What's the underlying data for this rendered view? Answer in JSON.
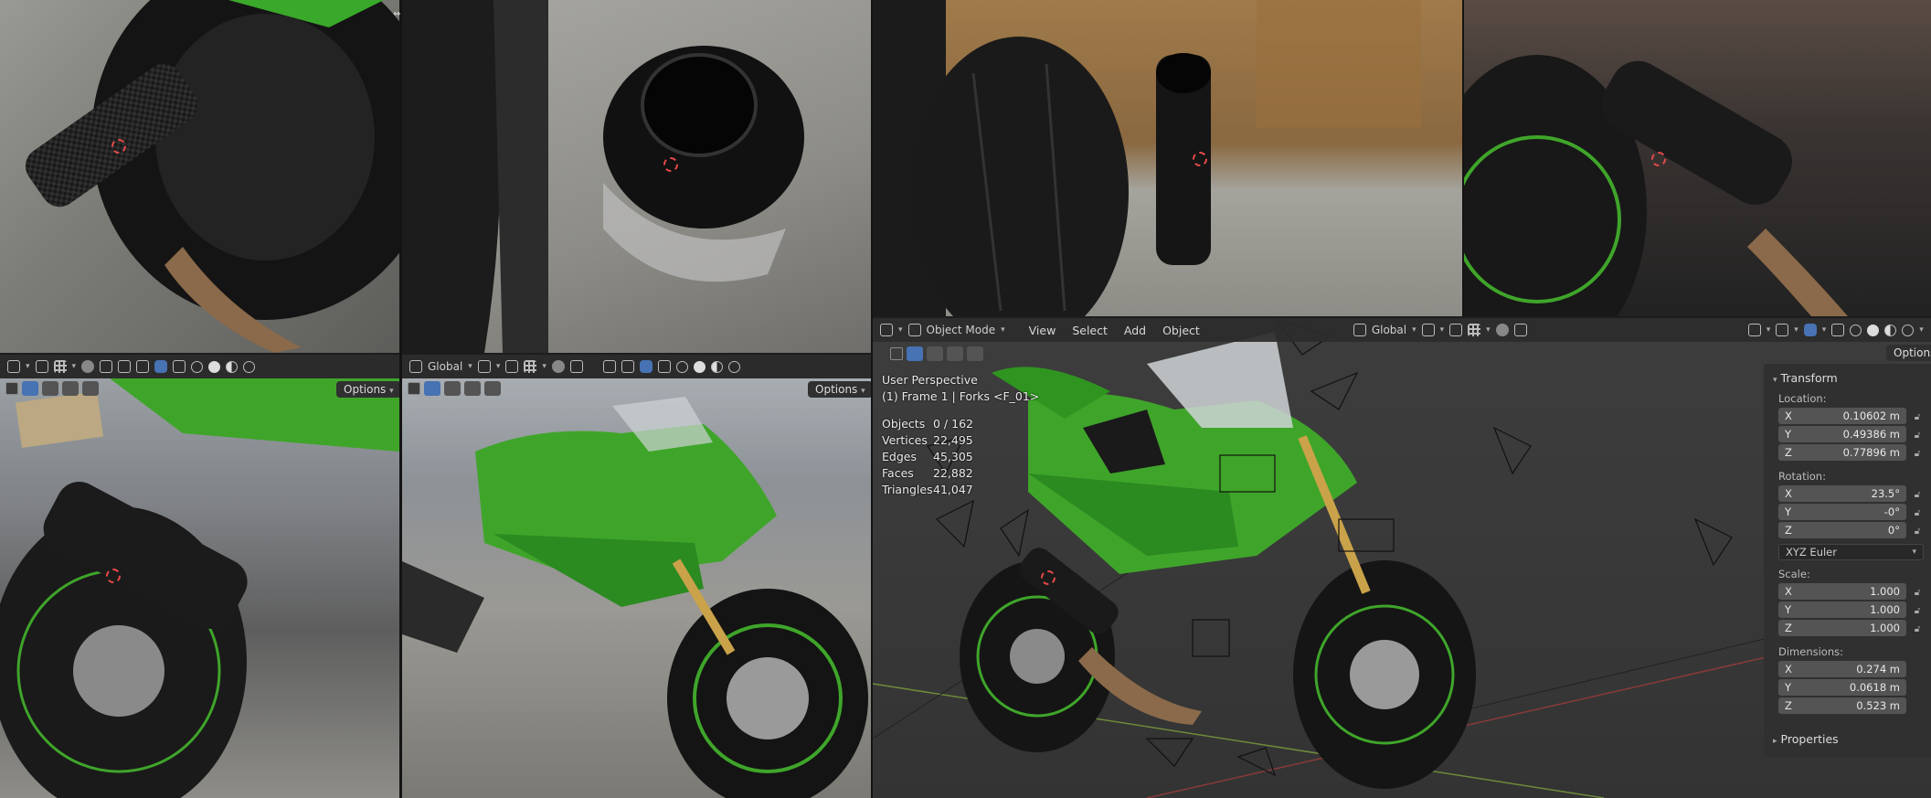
{
  "colors": {
    "accent_blue": "#4772b3",
    "bike_green": "#3fa52a",
    "toolbar_bg": "#2b2b2b"
  },
  "top_left_panel": {
    "divider_icon": "double-arrow-icon"
  },
  "bottom_left_toolbar": {
    "options_label": "Options"
  },
  "bottom_mid_toolbar": {
    "orientation_label": "Global",
    "options_label": "Options"
  },
  "main_viewport": {
    "header": {
      "mode_label": "Object Mode",
      "menus": [
        "View",
        "Select",
        "Add",
        "Object"
      ],
      "orientation_label": "Global",
      "options_label": "Options"
    },
    "overlay": {
      "perspective": "User Perspective",
      "frame_info": "(1) Frame 1 | Forks <F_01>"
    },
    "stats": [
      {
        "label": "Objects",
        "value": "0 / 162"
      },
      {
        "label": "Vertices",
        "value": "22,495"
      },
      {
        "label": "Edges",
        "value": "45,305"
      },
      {
        "label": "Faces",
        "value": "22,882"
      },
      {
        "label": "Triangles",
        "value": "41,047"
      }
    ]
  },
  "n_panel": {
    "transform_title": "Transform",
    "location_label": "Location:",
    "location": [
      {
        "axis": "X",
        "value": "0.10602 m"
      },
      {
        "axis": "Y",
        "value": "0.49386 m"
      },
      {
        "axis": "Z",
        "value": "0.77896 m"
      }
    ],
    "rotation_label": "Rotation:",
    "rotation": [
      {
        "axis": "X",
        "value": "23.5°"
      },
      {
        "axis": "Y",
        "value": "-0°"
      },
      {
        "axis": "Z",
        "value": "0°"
      }
    ],
    "rotation_mode": "XYZ Euler",
    "scale_label": "Scale:",
    "scale": [
      {
        "axis": "X",
        "value": "1.000"
      },
      {
        "axis": "Y",
        "value": "1.000"
      },
      {
        "axis": "Z",
        "value": "1.000"
      }
    ],
    "dimensions_label": "Dimensions:",
    "dimensions": [
      {
        "axis": "X",
        "value": "0.274 m"
      },
      {
        "axis": "Y",
        "value": "0.0618 m"
      },
      {
        "axis": "Z",
        "value": "0.523 m"
      }
    ],
    "properties_title": "Properties"
  }
}
